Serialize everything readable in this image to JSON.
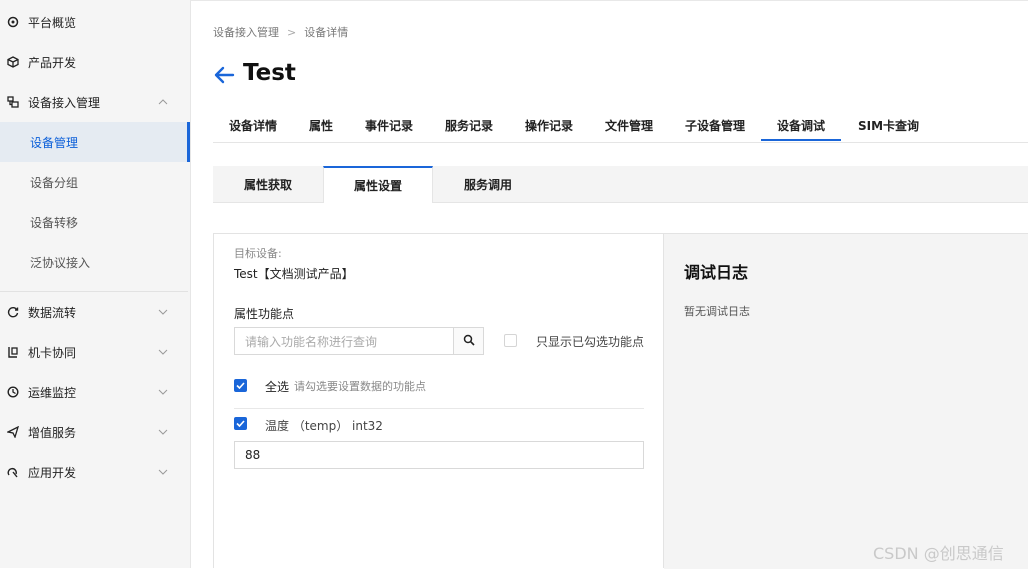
{
  "sidebar": {
    "items": [
      {
        "label": "平台概览",
        "icon": "dashboard-icon"
      },
      {
        "label": "产品开发",
        "icon": "cube-icon"
      },
      {
        "label": "设备接入管理",
        "icon": "devices-icon"
      },
      {
        "label": "数据流转",
        "icon": "flow-icon"
      },
      {
        "label": "机卡协同",
        "icon": "sim-link-icon"
      },
      {
        "label": "运维监控",
        "icon": "monitor-icon"
      },
      {
        "label": "增值服务",
        "icon": "send-icon"
      },
      {
        "label": "应用开发",
        "icon": "app-icon"
      }
    ],
    "subitems": [
      {
        "label": "设备管理",
        "active": true
      },
      {
        "label": "设备分组"
      },
      {
        "label": "设备转移"
      },
      {
        "label": "泛协议接入"
      }
    ]
  },
  "breadcrumb": {
    "parent": "设备接入管理",
    "separator": ">",
    "current": "设备详情"
  },
  "page": {
    "title": "Test"
  },
  "tabs": [
    "设备详情",
    "属性",
    "事件记录",
    "服务记录",
    "操作记录",
    "文件管理",
    "子设备管理",
    "设备调试",
    "SIM卡查询"
  ],
  "active_tab": "设备调试",
  "subtabs": [
    "属性获取",
    "属性设置",
    "服务调用"
  ],
  "active_subtab": "属性设置",
  "form": {
    "target_label": "目标设备:",
    "target_value": "Test【文档测试产品】",
    "feature_label": "属性功能点",
    "search_placeholder": "请输入功能名称进行查询",
    "only_checked_label": "只显示已勾选功能点",
    "select_all_label": "全选",
    "select_all_hint": "请勾选要设置数据的功能点",
    "property_label": "温度 （temp） int32",
    "property_value": "88"
  },
  "log": {
    "title": "调试日志",
    "empty": "暂无调试日志"
  },
  "watermark": "CSDN @创思通信",
  "colors": {
    "accent": "#1a66d9",
    "sidebar_bg": "#f5f5f5",
    "active_bg": "#e5ebf2"
  }
}
